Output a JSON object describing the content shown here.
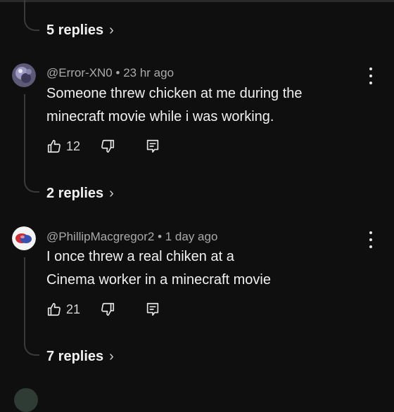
{
  "top_thread": {
    "replies_label": "5 replies",
    "chevron": "›"
  },
  "comments": [
    {
      "handle": "@Error-XN0",
      "separator": "•",
      "time": "23 hr ago",
      "text_lines": [
        "Someone threw chicken at me during the",
        "minecraft movie while i was working."
      ],
      "likes": "12",
      "replies_label": "2 replies"
    },
    {
      "handle": "@PhillipMacgregor2",
      "separator": "•",
      "time": "1 day ago",
      "text_lines": [
        "I once threw a real chiken at a",
        "Cinema worker in a minecraft movie"
      ],
      "likes": "21",
      "replies_label": "7 replies"
    }
  ],
  "icons": [
    "thumbs-up-icon",
    "thumbs-down-icon",
    "reply-comment-icon",
    "more-vert-icon",
    "chevron-right-icon"
  ]
}
